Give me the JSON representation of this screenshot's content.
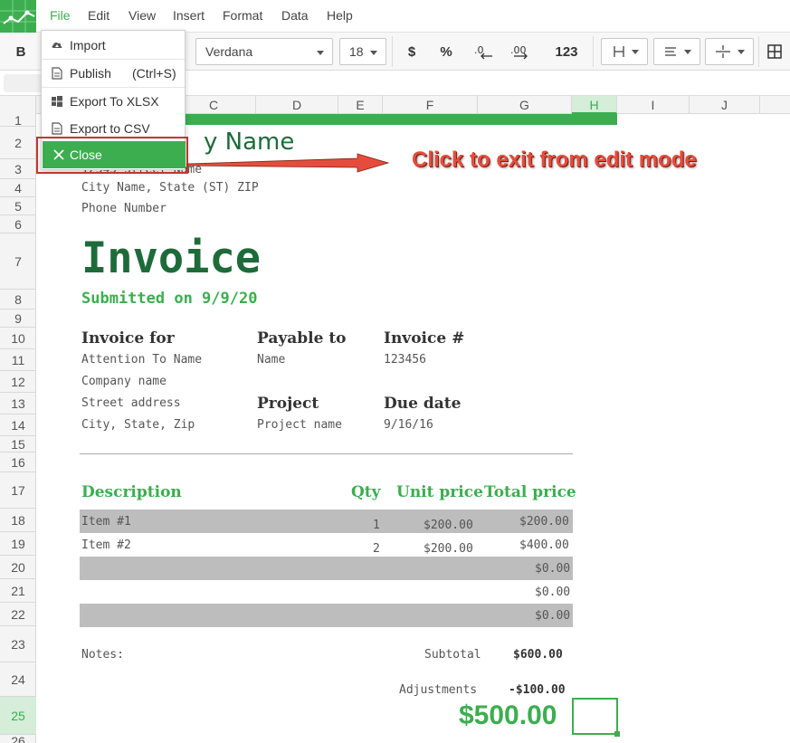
{
  "menu": [
    "File",
    "Edit",
    "View",
    "Insert",
    "Format",
    "Data",
    "Help"
  ],
  "file_menu": {
    "import": "Import",
    "publish": "Publish",
    "publish_shortcut": "(Ctrl+S)",
    "export_xlsx": "Export To XLSX",
    "export_csv": "Export to CSV",
    "close": "Close"
  },
  "toolbar": {
    "bold": "B",
    "font": "Verdana",
    "size": "18",
    "currency": "$",
    "percent": "%",
    "number_format": "123"
  },
  "columns": [
    "C",
    "D",
    "E",
    "F",
    "G",
    "H",
    "I",
    "J"
  ],
  "rows": [
    "1",
    "2",
    "3",
    "4",
    "5",
    "6",
    "7",
    "8",
    "9",
    "10",
    "11",
    "12",
    "13",
    "14",
    "15",
    "16",
    "17",
    "18",
    "19",
    "20",
    "21",
    "22",
    "23",
    "24",
    "25",
    "26"
  ],
  "sheet": {
    "company_name_partial": "y Name",
    "street": "12345  Street Name",
    "city": "City Name,  State (ST) ZIP",
    "phone": "Phone Number",
    "invoice_title": "Invoice",
    "submitted": "Submitted on 9/9/20",
    "invoice_for_label": "Invoice for",
    "attention": "Attention To Name",
    "company": "Company name",
    "street_address": "Street address",
    "city_state_zip": "City, State, Zip",
    "payable_label": "Payable to",
    "payable_name": "Name",
    "project_label": "Project",
    "project_name": "Project name",
    "invoice_no_label": "Invoice #",
    "invoice_no": "123456",
    "due_label": "Due date",
    "due_date": "9/16/16",
    "col_description": "Description",
    "col_qty": "Qty",
    "col_unit": "Unit price",
    "col_total": "Total price",
    "items": [
      {
        "desc": "Item #1",
        "qty": "1",
        "unit": "$200.00",
        "total": "$200.00"
      },
      {
        "desc": "Item #2",
        "qty": "2",
        "unit": "$200.00",
        "total": "$400.00"
      },
      {
        "desc": "",
        "qty": "",
        "unit": "",
        "total": "$0.00"
      },
      {
        "desc": "",
        "qty": "",
        "unit": "",
        "total": "$0.00"
      },
      {
        "desc": "",
        "qty": "",
        "unit": "",
        "total": "$0.00"
      }
    ],
    "notes_label": "Notes:",
    "subtotal_label": "Subtotal",
    "subtotal": "$600.00",
    "adjustments_label": "Adjustments",
    "adjustments": "-$100.00",
    "grand_total": "$500.00"
  },
  "annotation": "Click to exit from edit mode",
  "colors": {
    "accent": "#3cae4f",
    "dark_green": "#1e6b3a",
    "annotation": "#e64c3c",
    "shade": "#bdbdbd"
  }
}
